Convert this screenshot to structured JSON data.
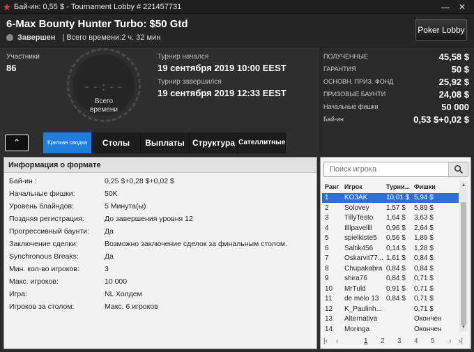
{
  "window": {
    "title": "Бай-ин: 0,55 $ - Tournament Lobby # 221457731",
    "min": "—",
    "close": "✕"
  },
  "header": {
    "name": "6-Max Bounty Hunter Turbo: $50 Gtd",
    "status": "Завершен",
    "total_time": "| Всего времени:2 ч. 32 мин",
    "poker_lobby": "Poker Lobby"
  },
  "info": {
    "participants_label": "Участники",
    "participants_value": "86",
    "clock_time": "--:--",
    "clock_label_1": "Всего",
    "clock_label_2": "времени",
    "started_label": "Турнир начался",
    "started_value": "19 сентября 2019   10:00 EEST",
    "ended_label": "Турнир завершился",
    "ended_value": "19 сентября 2019   12:33 EEST"
  },
  "stats": [
    {
      "k": "ПОЛУЧЕННЫЕ",
      "v": "45,58 $"
    },
    {
      "k": "ГАРАНТИЯ",
      "v": "50 $"
    },
    {
      "k": "ОСНОВН. ПРИЗ. ФОНД",
      "v": "25,92 $"
    },
    {
      "k": "ПРИЗОВЫЕ БАУНТИ",
      "v": "24,08 $"
    },
    {
      "k": "Начальные фишки",
      "v": "50 000"
    },
    {
      "k": "Бай-ин",
      "v": "0,53 $+0,02 $"
    }
  ],
  "tabs": {
    "collapse": "⌃",
    "summary": "Краткая сводка",
    "tables": "Столы",
    "payouts": "Выплаты",
    "structure": "Структура",
    "satellites": "Сателлитные"
  },
  "format": {
    "heading": "Информация о формате",
    "rows": [
      {
        "k": "Бай-ин :",
        "v": "0,25 $+0,28 $+0,02 $"
      },
      {
        "k": "Начальные фишки:",
        "v": "50K"
      },
      {
        "k": "Уровень блайндов:",
        "v": "5 Минута(ы)"
      },
      {
        "k": "Поздняя регистрация:",
        "v": "До завершения уровня 12"
      },
      {
        "k": "Прогрессивный баунти:",
        "v": "Да"
      },
      {
        "k": "Заключение сделки:",
        "v": "Возможно заключение сделок за финальным столом."
      },
      {
        "k": "Synchronous Breaks:",
        "v": "Да"
      },
      {
        "k": "Мин. кол-во игроков:",
        "v": "3"
      },
      {
        "k": "Макс. игроков:",
        "v": "10 000"
      },
      {
        "k": "Игра:",
        "v": "NL Холдем"
      },
      {
        "k": "Игроков за столом:",
        "v": "Макс. 6 игроков"
      }
    ]
  },
  "players": {
    "search_placeholder": "Поиск игрока",
    "headers": {
      "rank": "Ранг",
      "player": "Игрок",
      "tour": "Турни...",
      "chips": "Фишки"
    },
    "rows": [
      {
        "rank": "1",
        "player": "KO3AK",
        "tour": "10,01 $",
        "chips": "5,94 $"
      },
      {
        "rank": "2",
        "player": "Solovey",
        "tour": "1,57 $",
        "chips": "5,89 $"
      },
      {
        "rank": "3",
        "player": "TillyTesto",
        "tour": "1,64 $",
        "chips": "3,63 $"
      },
      {
        "rank": "4",
        "player": "Illlpavellll",
        "tour": "0,96 $",
        "chips": "2,64 $"
      },
      {
        "rank": "5",
        "player": "spielkiste5",
        "tour": "0,56 $",
        "chips": "1,89 $"
      },
      {
        "rank": "6",
        "player": "Saltik456",
        "tour": "0,14 $",
        "chips": "1,28 $"
      },
      {
        "rank": "7",
        "player": "Oskarvit77...",
        "tour": "1,61 $",
        "chips": "0,84 $"
      },
      {
        "rank": "8",
        "player": "Chupakabra",
        "tour": "0,84 $",
        "chips": "0,84 $"
      },
      {
        "rank": "9",
        "player": "shira76",
        "tour": "0,84 $",
        "chips": "0,71 $"
      },
      {
        "rank": "10",
        "player": "MrTuld",
        "tour": "0,91 $",
        "chips": "0,71 $"
      },
      {
        "rank": "11",
        "player": "de melo 13",
        "tour": "0,84 $",
        "chips": "0,71 $"
      },
      {
        "rank": "12",
        "player": "K_Paulinh...",
        "tour": "",
        "chips": "0,71 $"
      },
      {
        "rank": "13",
        "player": "Alternativa",
        "tour": "",
        "chips": "Окончен"
      },
      {
        "rank": "14",
        "player": "Moringa",
        "tour": "",
        "chips": "Окончен"
      }
    ],
    "pager": {
      "first": "|‹",
      "prev": "‹",
      "pages": [
        "1",
        "2",
        "3",
        "4",
        "5"
      ],
      "next": "›",
      "last": "›|"
    }
  },
  "colors": {
    "accent": "#1e7ed9",
    "selected": "#2e6fcf",
    "logo": "#e23b2e"
  }
}
